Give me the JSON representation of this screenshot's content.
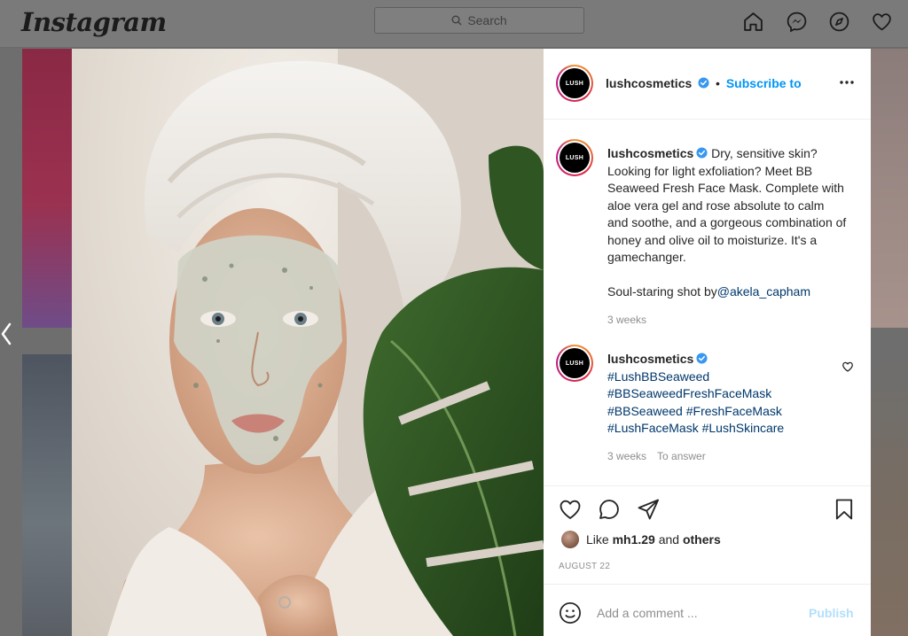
{
  "header": {
    "logo_text": "Instagram",
    "search_placeholder": "Search",
    "nav_icons": [
      "home-icon",
      "messenger-icon",
      "explore-icon",
      "activity-heart-icon"
    ]
  },
  "post": {
    "avatar_text": "LUSH",
    "username": "lushcosmetics",
    "separator": "•",
    "subscribe_label": "Subscribe to",
    "caption": {
      "text": "Dry, sensitive skin? Looking for light exfoliation? Meet BB Seaweed Fresh Face Mask. Complete with aloe vera gel and rose absolute to calm and soothe, and a gorgeous combination of honey and olive oil to moisturize. It's a gamechanger.\n\nSoul-staring shot by",
      "mention": "@akela_capham",
      "time": "3 weeks"
    },
    "comment": {
      "hashtags": [
        "#LushBBSeaweed",
        "#BBSeaweedFreshFaceMask",
        "#BBSeaweed",
        "#FreshFaceMask",
        "#LushFaceMask",
        "#LushSkincare"
      ],
      "time": "3 weeks",
      "reply_label": "To answer"
    },
    "likes": {
      "prefix": "Like",
      "user": "mh1.29",
      "joiner": "and",
      "others": "others"
    },
    "date": "AUGUST 22",
    "add_comment_placeholder": "Add a comment ...",
    "publish_label": "Publish"
  },
  "colors": {
    "accent": "#0095f6",
    "link": "#00376b",
    "muted": "#8e8e8e",
    "publish_disabled": "#b2dffc"
  }
}
